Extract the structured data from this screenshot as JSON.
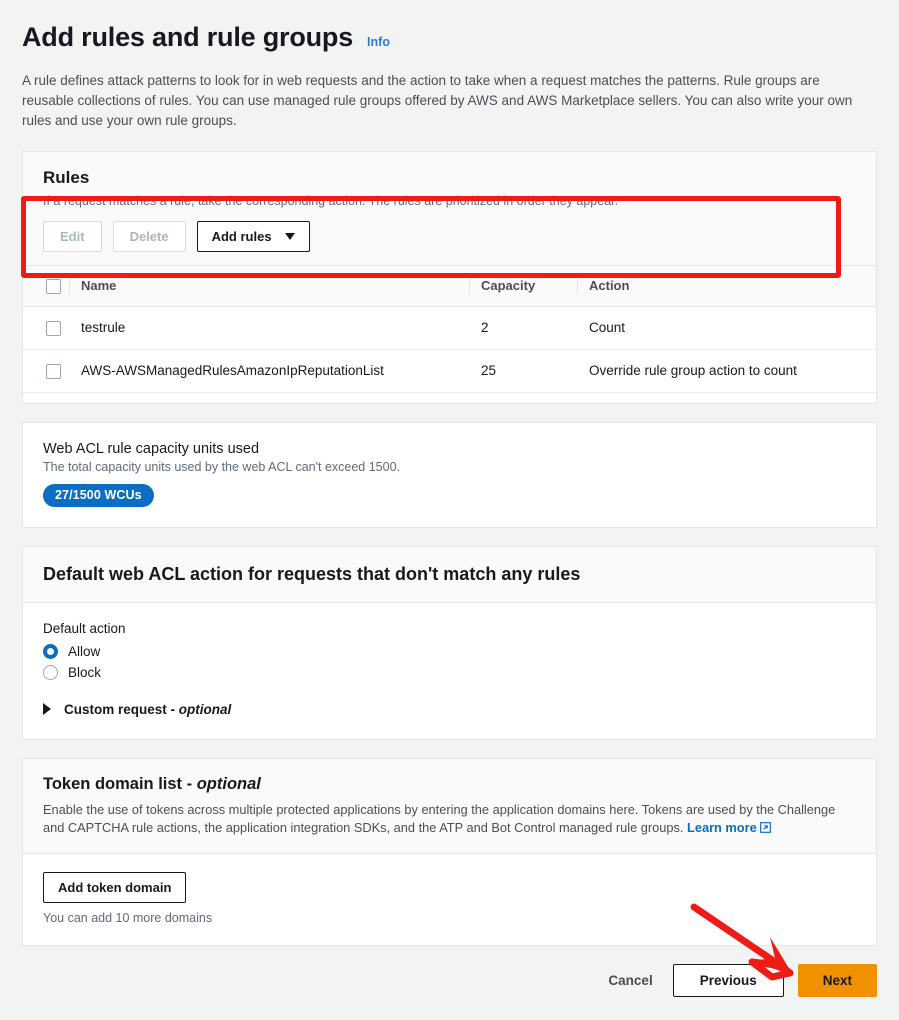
{
  "header": {
    "title": "Add rules and rule groups",
    "info_label": "Info",
    "description": "A rule defines attack patterns to look for in web requests and the action to take when a request matches the patterns. Rule groups are reusable collections of rules. You can use managed rule groups offered by AWS and AWS Marketplace sellers. You can also write your own rules and use your own rule groups."
  },
  "rules_panel": {
    "title": "Rules",
    "subtitle": "If a request matches a rule, take the corresponding action. The rules are prioritized in order they appear.",
    "edit_label": "Edit",
    "delete_label": "Delete",
    "add_rules_label": "Add rules",
    "columns": [
      "Name",
      "Capacity",
      "Action"
    ],
    "rows": [
      {
        "name": "testrule",
        "capacity": "2",
        "action": "Count"
      },
      {
        "name": "AWS-AWSManagedRulesAmazonIpReputationList",
        "capacity": "25",
        "action": "Override rule group action to count"
      }
    ]
  },
  "capacity_panel": {
    "title": "Web ACL rule capacity units used",
    "subtitle": "The total capacity units used by the web ACL can't exceed 1500.",
    "badge": "27/1500 WCUs",
    "badge_color": "#0a6fc2"
  },
  "default_action_panel": {
    "title": "Default web ACL action for requests that don't match any rules",
    "field_label": "Default action",
    "options": [
      {
        "label": "Allow",
        "selected": true
      },
      {
        "label": "Block",
        "selected": false
      }
    ],
    "expandable_label": "Custom request - ",
    "expandable_optional": "optional"
  },
  "token_panel": {
    "title": "Token domain list - ",
    "title_optional": "optional",
    "description": "Enable the use of tokens across multiple protected applications by entering the application domains here. Tokens are used by the Challenge and CAPTCHA rule actions, the application integration SDKs, and the ATP and Bot Control managed rule groups. ",
    "learn_more_label": "Learn more",
    "add_token_domain_label": "Add token domain",
    "hint": "You can add 10 more domains"
  },
  "footer": {
    "cancel_label": "Cancel",
    "previous_label": "Previous",
    "next_label": "Next",
    "next_color": "#f29100"
  },
  "annotations": {
    "highlight_color": "#ed1c16",
    "arrow_color": "#ed1c16"
  }
}
